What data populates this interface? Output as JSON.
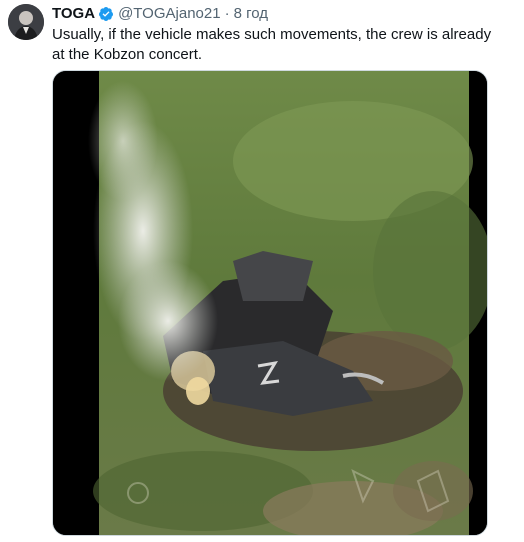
{
  "tweet": {
    "author_name": "TOGA",
    "handle": "@TOGAjano21",
    "separator": "·",
    "time": "8 год",
    "text": "Usually, if the vehicle makes such movements, the crew is already at the Kobzon concert."
  },
  "icons": {
    "verified": "verified-badge-icon"
  },
  "colors": {
    "verified_blue": "#1d9bf0",
    "secondary_text": "#536471",
    "primary_text": "#0f1419",
    "media_border": "#cfd9de"
  }
}
